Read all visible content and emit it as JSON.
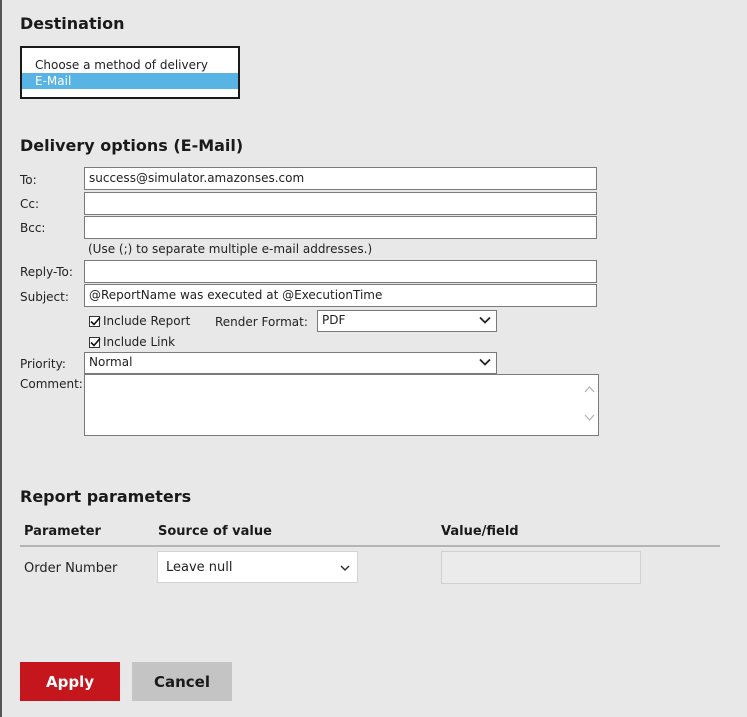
{
  "destination": {
    "heading": "Destination",
    "options": [
      "Choose a method of delivery",
      "E-Mail"
    ],
    "selected": "E-Mail"
  },
  "delivery": {
    "heading": "Delivery options (E-Mail)",
    "to_label": "To:",
    "to_value": "success@simulator.amazonses.com",
    "cc_label": "Cc:",
    "cc_value": "",
    "bcc_label": "Bcc:",
    "bcc_value": "",
    "separator_hint": "(Use (;) to separate multiple e-mail addresses.)",
    "reply_to_label": "Reply-To:",
    "reply_to_value": "",
    "subject_label": "Subject:",
    "subject_value": "@ReportName was executed at @ExecutionTime",
    "include_report_label": "Include Report",
    "include_report_checked": true,
    "render_format_label": "Render Format:",
    "render_format_value": "PDF",
    "include_link_label": "Include Link",
    "include_link_checked": true,
    "priority_label": "Priority:",
    "priority_value": "Normal",
    "comment_label": "Comment:",
    "comment_value": ""
  },
  "parameters": {
    "heading": "Report parameters",
    "col_parameter": "Parameter",
    "col_source": "Source of value",
    "col_value": "Value/field",
    "rows": [
      {
        "parameter": "Order Number",
        "source": "Leave null",
        "value": ""
      }
    ]
  },
  "actions": {
    "apply_label": "Apply",
    "cancel_label": "Cancel"
  },
  "colors": {
    "apply_bg": "#c4161c",
    "selected_option_bg": "#59b4e6",
    "cancel_bg": "#c4c4c4"
  }
}
